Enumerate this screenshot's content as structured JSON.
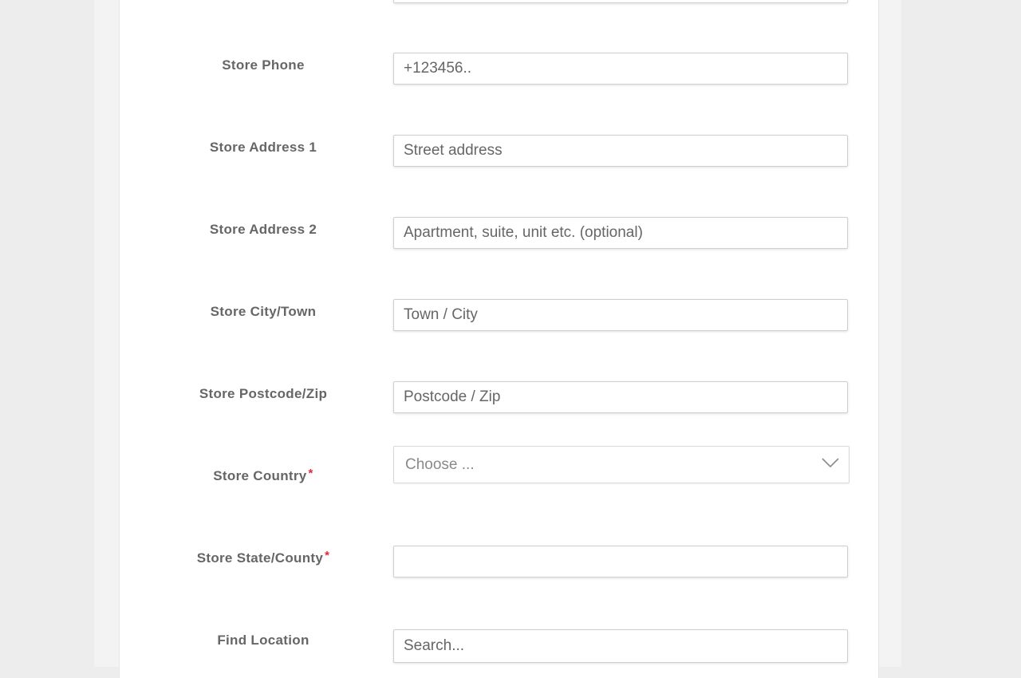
{
  "form": {
    "fields": [
      {
        "id": "store-phone",
        "label": "Store Phone",
        "placeholder": "+123456..",
        "value": "",
        "required": false
      },
      {
        "id": "store-address-1",
        "label": "Store Address 1",
        "placeholder": "Street address",
        "value": "",
        "required": false
      },
      {
        "id": "store-address-2",
        "label": "Store Address 2",
        "placeholder": "Apartment, suite, unit etc. (optional)",
        "value": "",
        "required": false
      },
      {
        "id": "store-city",
        "label": "Store City/Town",
        "placeholder": "Town / City",
        "value": "",
        "required": false
      },
      {
        "id": "store-postcode",
        "label": "Store Postcode/Zip",
        "placeholder": "Postcode / Zip",
        "value": "",
        "required": false
      },
      {
        "id": "store-country",
        "label": "Store Country",
        "selected": "Choose ...",
        "required": true
      },
      {
        "id": "store-state",
        "label": "Store State/County",
        "placeholder": "",
        "value": "",
        "required": true
      },
      {
        "id": "find-location",
        "label": "Find Location",
        "placeholder": "Search...",
        "value": "",
        "required": false
      }
    ],
    "required_marker": "*"
  },
  "icons": {
    "country_dropdown": "chevron-down-icon"
  },
  "colors": {
    "required": "#e0293b",
    "label": "#666666",
    "background": "#ededed"
  }
}
